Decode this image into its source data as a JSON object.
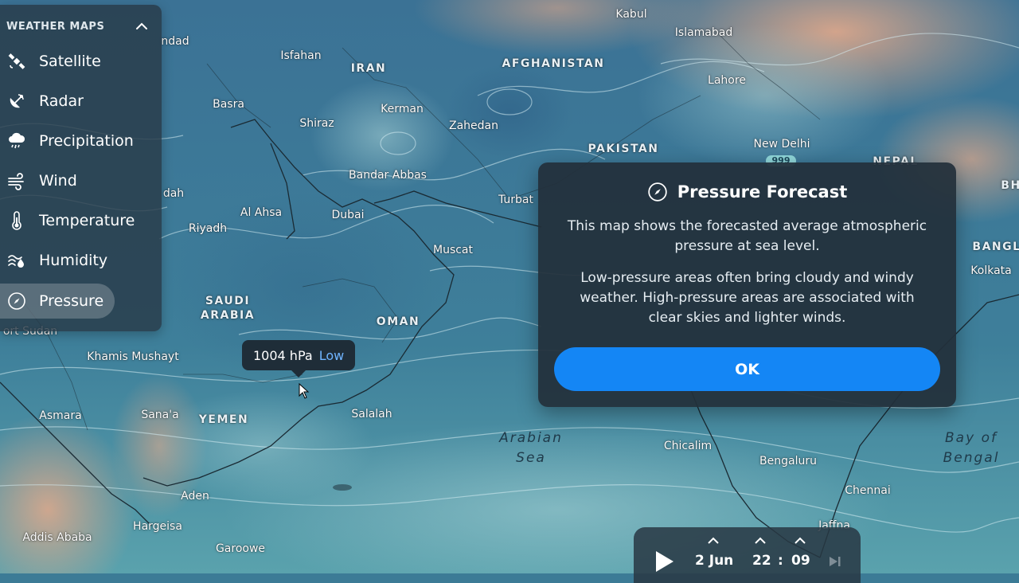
{
  "sidebar": {
    "heading": "WEATHER MAPS",
    "items": [
      {
        "label": "Satellite",
        "icon": "satellite-icon"
      },
      {
        "label": "Radar",
        "icon": "radar-icon"
      },
      {
        "label": "Precipitation",
        "icon": "precipitation-icon"
      },
      {
        "label": "Wind",
        "icon": "wind-icon"
      },
      {
        "label": "Temperature",
        "icon": "thermometer-icon"
      },
      {
        "label": "Humidity",
        "icon": "humidity-icon"
      },
      {
        "label": "Pressure",
        "icon": "compass-icon",
        "active": true
      }
    ]
  },
  "tooltip": {
    "value": "1004 hPa",
    "status": "Low"
  },
  "modal": {
    "title": "Pressure Forecast",
    "paragraph1": "This map shows the forecasted average atmospheric pressure at sea level.",
    "paragraph2": "Low-pressure areas often bring cloudy and windy weather. High-pressure areas are associated with clear skies and lighter winds.",
    "ok_label": "OK"
  },
  "timeline": {
    "date": "2 Jun",
    "hour": "22",
    "separator": ":",
    "minute": "09"
  },
  "map": {
    "badge": "999",
    "places": [
      "ndad",
      "Isfahan",
      "Kabul",
      "Islamabad",
      "Lahore",
      "Basra",
      "Kerman",
      "Shiraz",
      "Zahedan",
      "New Delhi",
      "Bandar Abbas",
      "Turbat",
      "dah",
      "Al Ahsa",
      "Dubai",
      "Riyadh",
      "Muscat",
      "Kolkata",
      "ort Sudan",
      "Khamis Mushayt",
      "Salalah",
      "Asmara",
      "Sana'a",
      "Chicalim",
      "Bengaluru",
      "Chennai",
      "Aden",
      "Hargeisa",
      "Addis Ababa",
      "Garoowe",
      "Jaffna"
    ],
    "countries": [
      "IRAN",
      "AFGHANISTAN",
      "PAKISTAN",
      "NEPAL",
      "BANGL",
      "SAUDI",
      "ARABIA",
      "OMAN",
      "YEMEN",
      "BH"
    ],
    "seas": [
      [
        "Arabian",
        "Sea"
      ],
      [
        "Bay of",
        "Bengal"
      ]
    ]
  }
}
